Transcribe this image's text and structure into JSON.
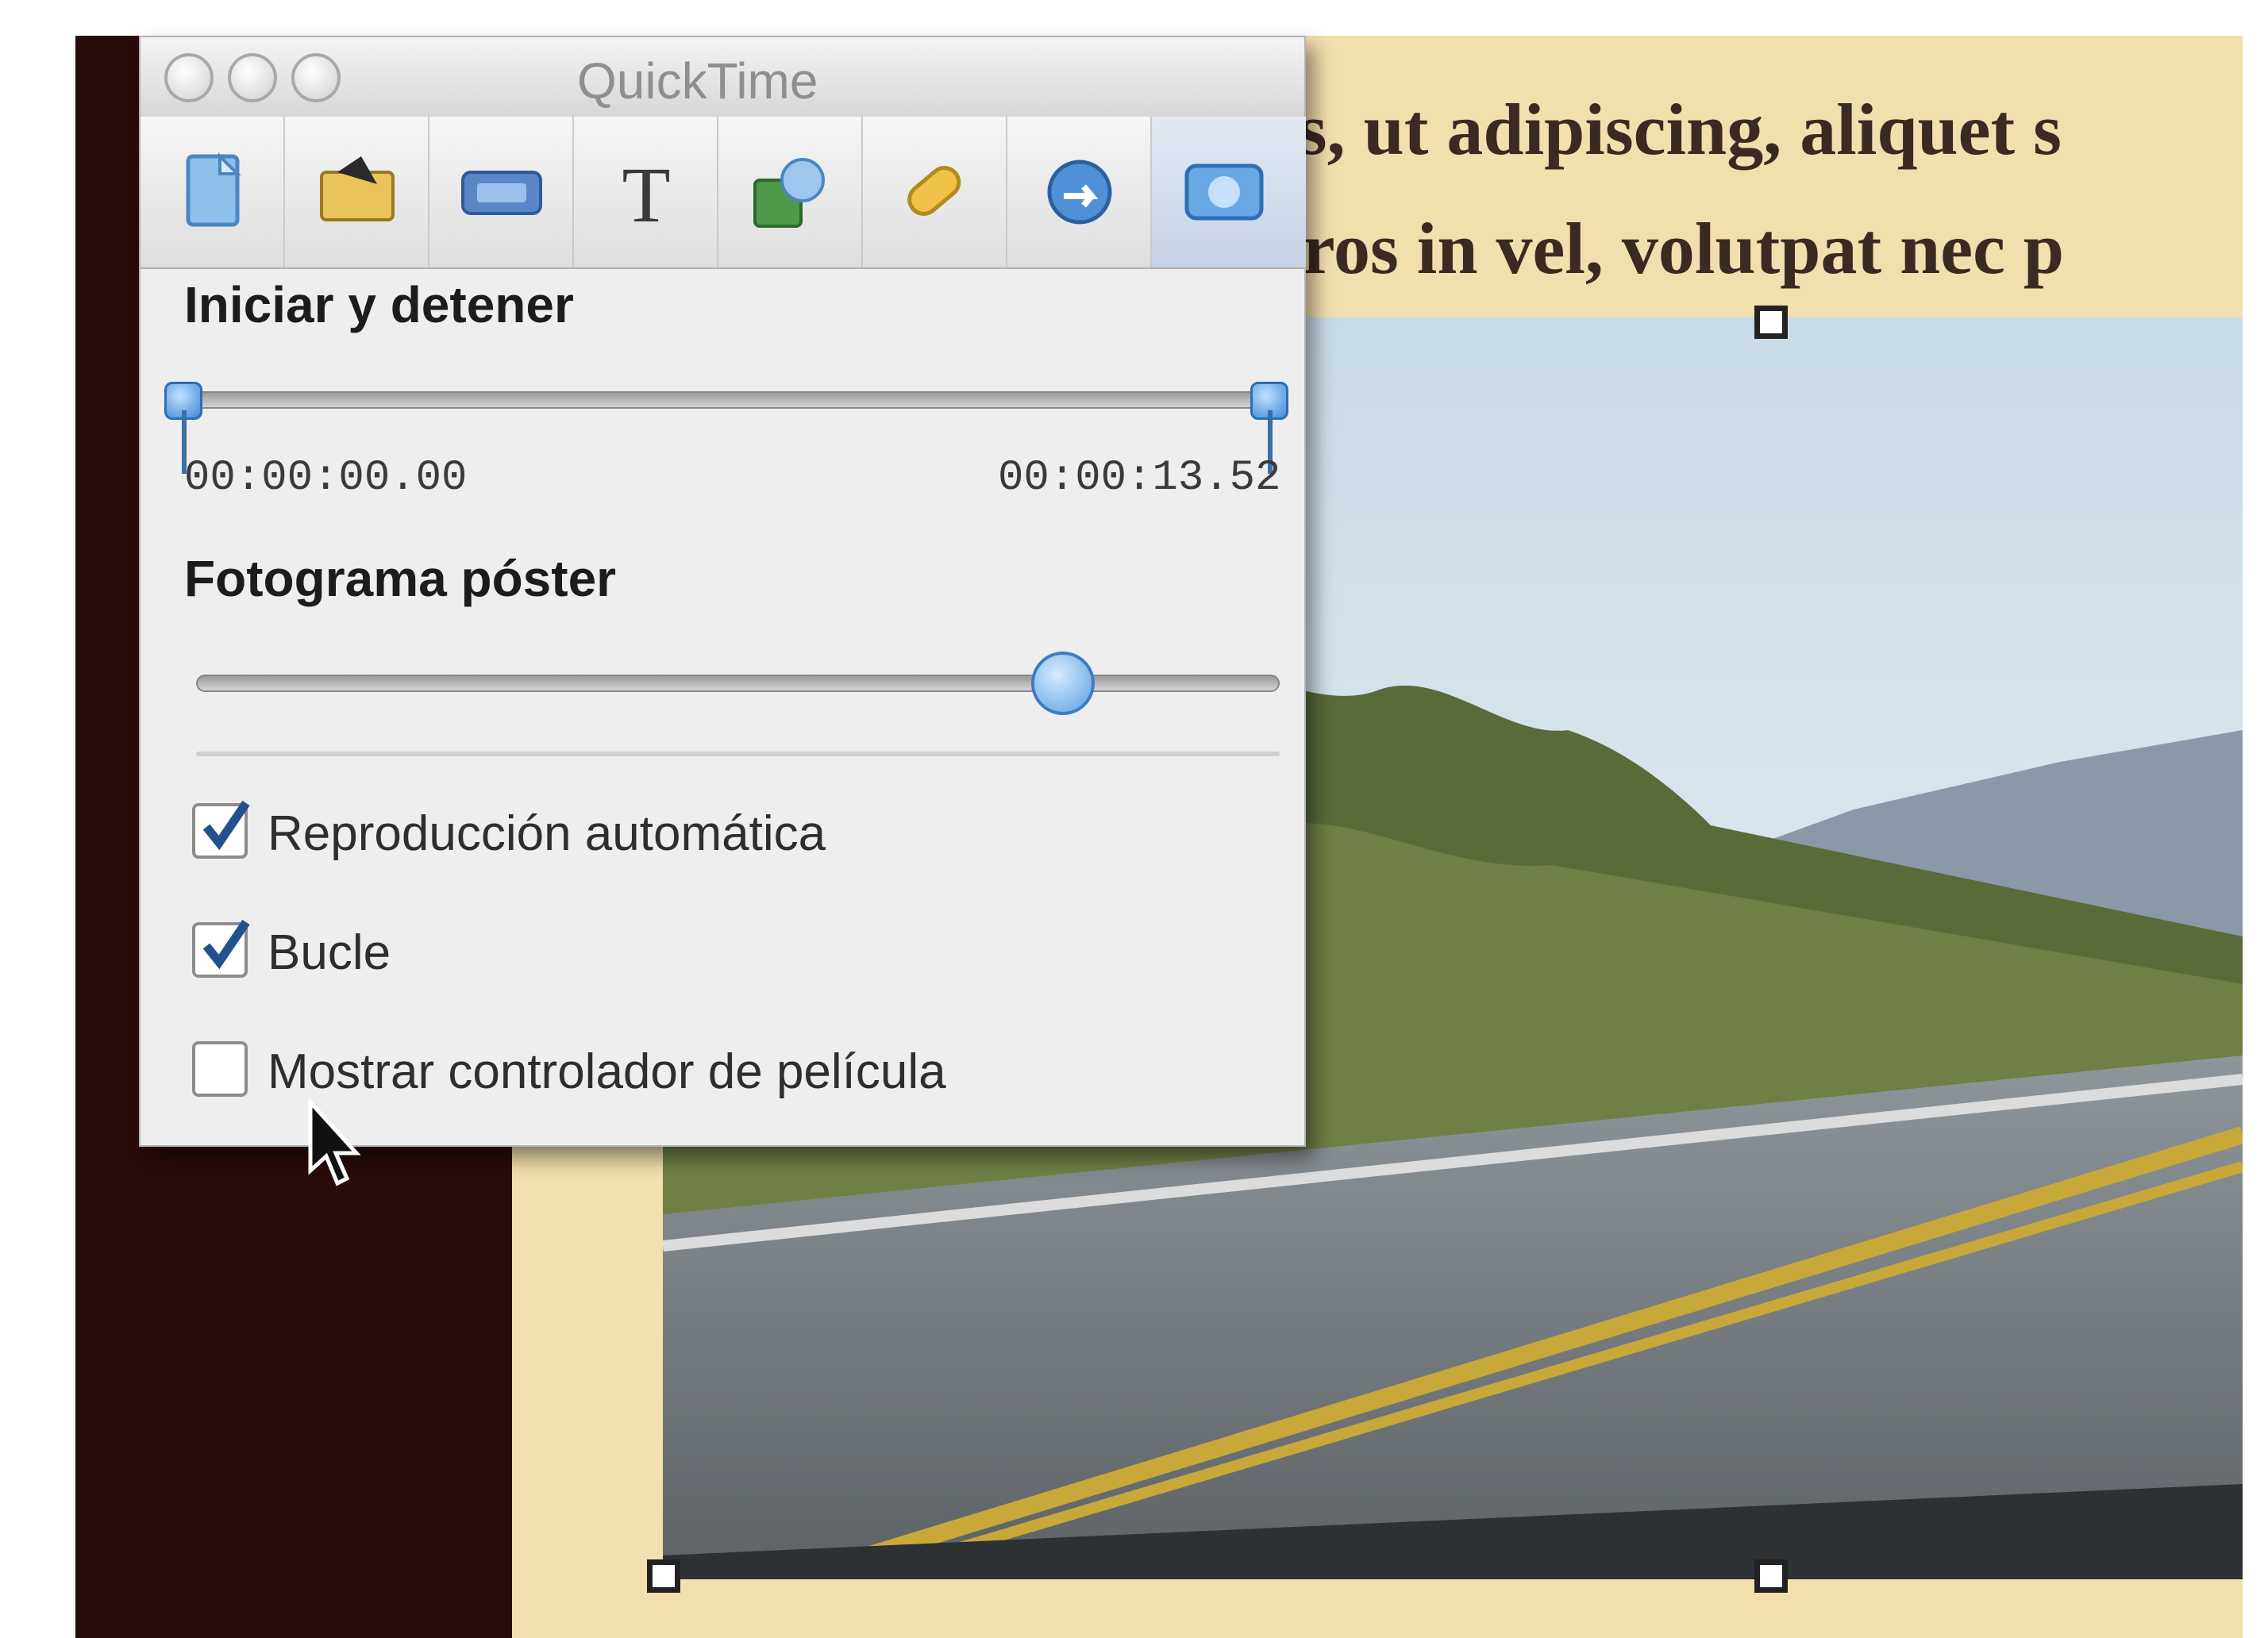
{
  "page": {
    "line1": "ss, ut adipiscing, aliquet s",
    "line2": "eros in vel, volutpat nec p"
  },
  "window": {
    "title": "QuickTime",
    "toolbar": [
      {
        "icon": "document-icon"
      },
      {
        "icon": "graphic-icon"
      },
      {
        "icon": "metrics-icon"
      },
      {
        "icon": "text-icon"
      },
      {
        "icon": "table-icon"
      },
      {
        "icon": "hyperlink-icon"
      },
      {
        "icon": "link-icon"
      },
      {
        "icon": "quicktime-icon",
        "active": true
      }
    ]
  },
  "start_stop": {
    "title": "Iniciar y detener",
    "start_time": "00:00:00.00",
    "end_time": "00:00:13.52"
  },
  "poster_frame": {
    "title": "Fotograma póster",
    "value": 0.8
  },
  "options": [
    {
      "label": "Reproducción automática",
      "checked": true
    },
    {
      "label": "Bucle",
      "checked": true
    },
    {
      "label": "Mostrar controlador de película",
      "checked": false
    }
  ],
  "colors": {
    "sidebar": "#2a0b0b",
    "paper": "#f2dfae",
    "accent": "#3e8ad8"
  }
}
